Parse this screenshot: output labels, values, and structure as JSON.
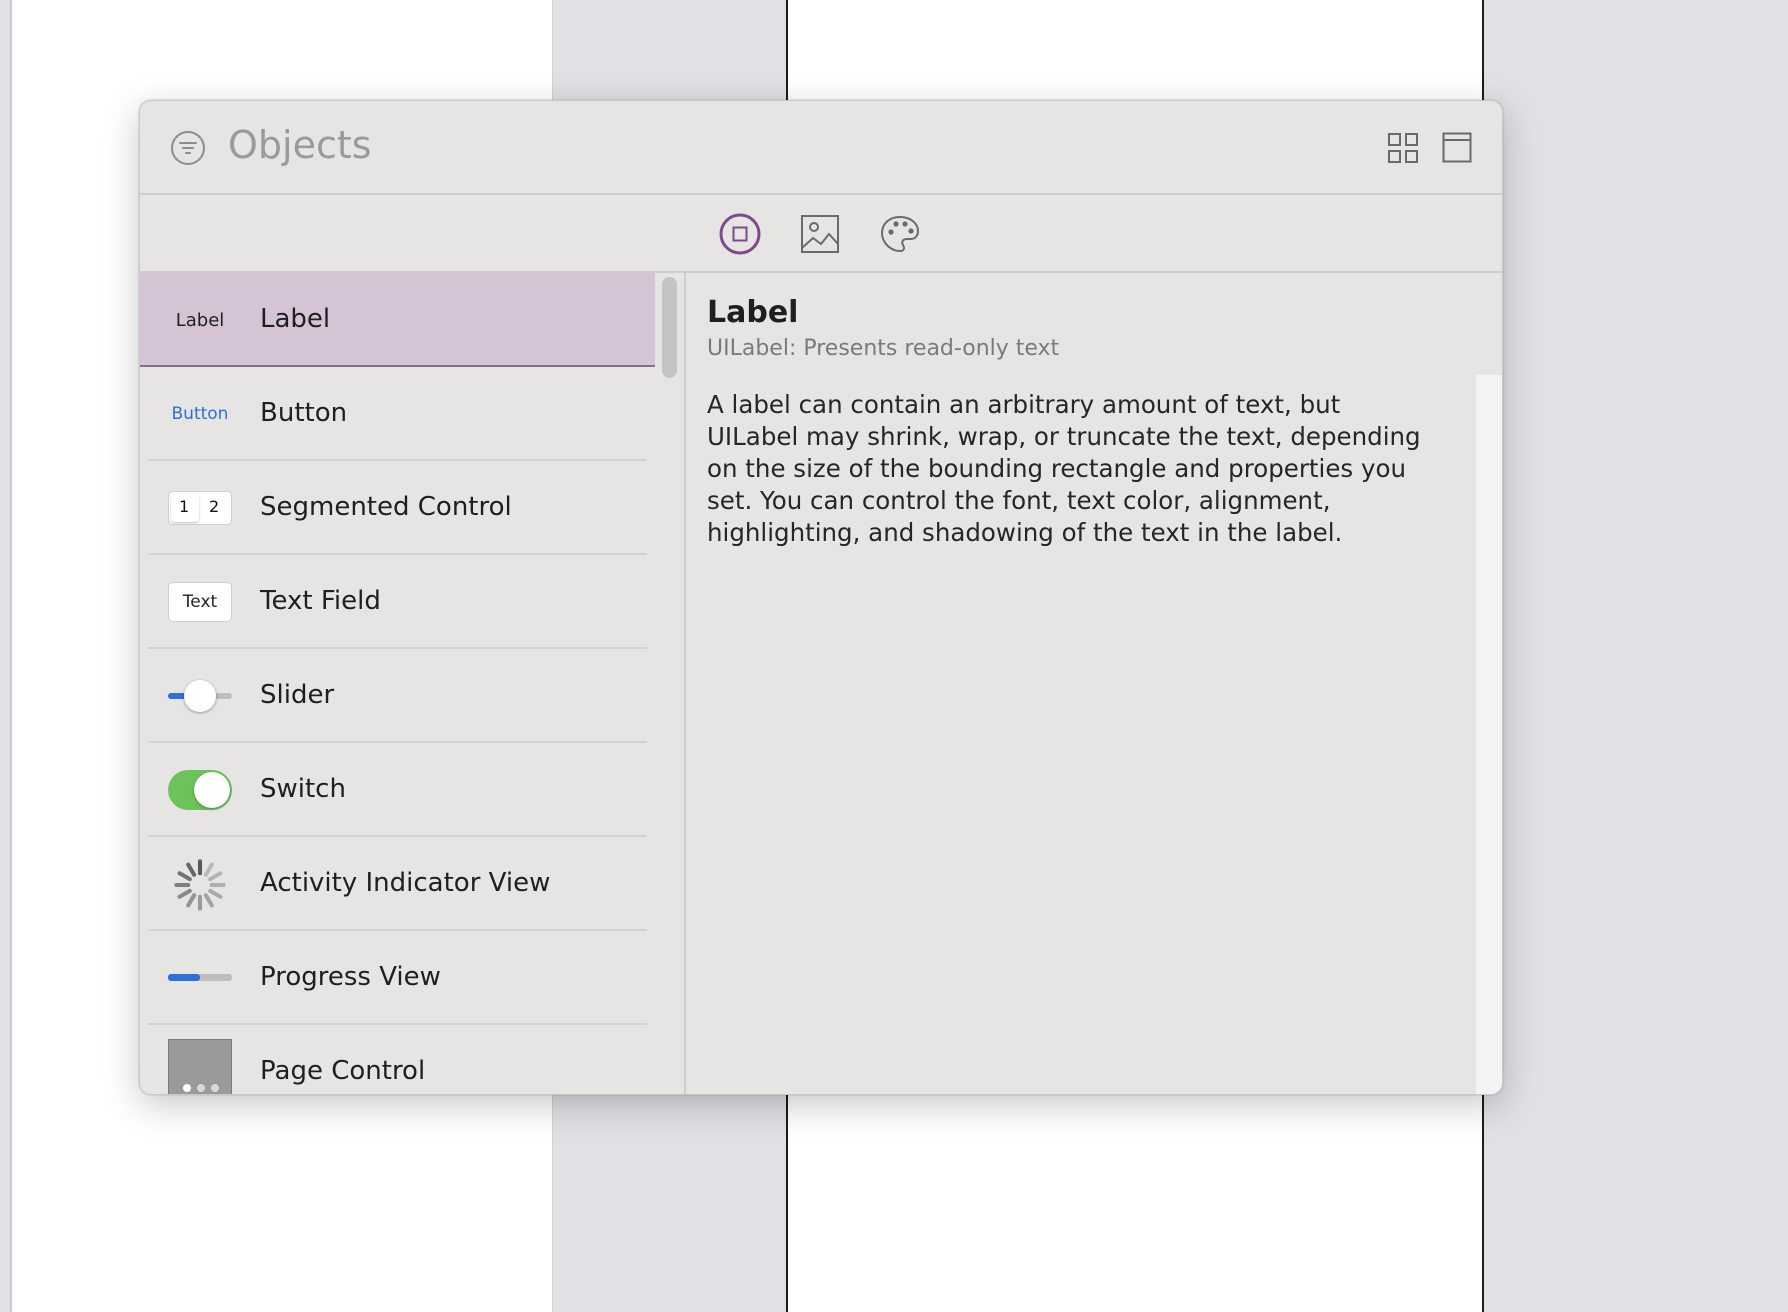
{
  "library": {
    "title": "Objects",
    "segments": [
      {
        "name": "objects",
        "selected": true
      },
      {
        "name": "images",
        "selected": false
      },
      {
        "name": "colors",
        "selected": false
      }
    ],
    "items": [
      {
        "label": "Label",
        "icon_text": "Label",
        "selected": true
      },
      {
        "label": "Button",
        "icon_text": "Button"
      },
      {
        "label": "Segmented Control",
        "icon_text_1": "1",
        "icon_text_2": "2"
      },
      {
        "label": "Text Field",
        "icon_text": "Text"
      },
      {
        "label": "Slider"
      },
      {
        "label": "Switch"
      },
      {
        "label": "Activity Indicator View"
      },
      {
        "label": "Progress View"
      },
      {
        "label": "Page Control"
      }
    ],
    "detail": {
      "title": "Label",
      "subtitle": "UILabel: Presents read-only text",
      "body": "A label can contain an arbitrary amount of text, but UILabel may shrink, wrap, or truncate the text, depending on the size of the bounding rectangle and properties you set. You can control the font, text color, alignment, highlighting, and shadowing of the text in the label."
    }
  },
  "colors": {
    "accent": "#7d4a8e",
    "selection_bg": "#d4c4d6",
    "button_blue": "#2f6fd6",
    "switch_green": "#6cc35a"
  }
}
